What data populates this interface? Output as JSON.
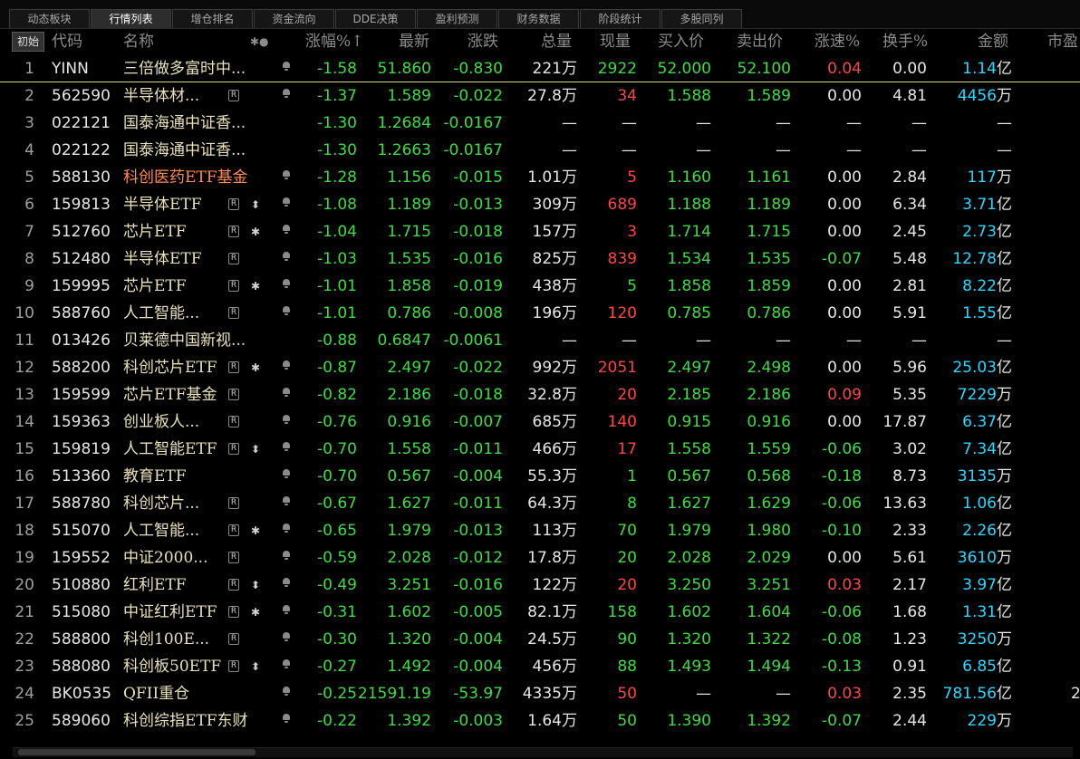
{
  "tabs": [
    "动态板块",
    "行情列表",
    "增仓排名",
    "资金流向",
    "DDE决策",
    "盈利预测",
    "财务数据",
    "阶段统计",
    "多股同列"
  ],
  "active_tab": 1,
  "init_label": "初始",
  "headers": {
    "code": "代码",
    "name": "名称",
    "icons": "✱●",
    "chg_pct": "涨幅%↑",
    "last": "最新",
    "chg": "涨跌",
    "vol": "总量",
    "cur": "现量",
    "bid": "买入价",
    "ask": "卖出价",
    "speed": "涨速%",
    "turnover": "换手%",
    "amount": "金额",
    "mktcap": "市盈"
  },
  "rows": [
    {
      "n": "1",
      "code": "YINN",
      "name": "三倍做多富时中...",
      "tag": "",
      "mark": "",
      "bell": true,
      "chg_pct": "-1.58",
      "last": "51.860",
      "chg": "-0.830",
      "vol": "221",
      "vol_u": "万",
      "cur": "2922",
      "cur_c": "g",
      "bid": "52.000",
      "ask": "52.100",
      "speed": "0.04",
      "speed_c": "r",
      "turn": "0.00",
      "amt": "1.14",
      "amt_u": "亿",
      "hl": false
    },
    {
      "n": "2",
      "code": "562590",
      "name": "半导体材...",
      "tag": "R",
      "mark": "",
      "bell": true,
      "chg_pct": "-1.37",
      "last": "1.589",
      "chg": "-0.022",
      "vol": "27.8",
      "vol_u": "万",
      "cur": "34",
      "cur_c": "r",
      "bid": "1.588",
      "ask": "1.589",
      "speed": "0.00",
      "speed_c": "w",
      "turn": "4.81",
      "amt": "4456",
      "amt_u": "万",
      "hl": false
    },
    {
      "n": "3",
      "code": "022121",
      "name": "国泰海通中证香...",
      "tag": "",
      "mark": "",
      "bell": false,
      "chg_pct": "-1.30",
      "last": "1.2684",
      "chg": "-0.0167",
      "vol": "—",
      "vol_u": "",
      "cur": "—",
      "cur_c": "w",
      "bid": "—",
      "ask": "—",
      "speed": "—",
      "speed_c": "w",
      "turn": "—",
      "amt": "—",
      "amt_u": "",
      "hl": false
    },
    {
      "n": "4",
      "code": "022122",
      "name": "国泰海通中证香...",
      "tag": "",
      "mark": "",
      "bell": false,
      "chg_pct": "-1.30",
      "last": "1.2663",
      "chg": "-0.0167",
      "vol": "—",
      "vol_u": "",
      "cur": "—",
      "cur_c": "w",
      "bid": "—",
      "ask": "—",
      "speed": "—",
      "speed_c": "w",
      "turn": "—",
      "amt": "—",
      "amt_u": "",
      "hl": false
    },
    {
      "n": "5",
      "code": "588130",
      "name": "科创医药ETF基金",
      "tag": "",
      "mark": "",
      "bell": true,
      "chg_pct": "-1.28",
      "last": "1.156",
      "chg": "-0.015",
      "vol": "1.01",
      "vol_u": "万",
      "cur": "5",
      "cur_c": "r",
      "bid": "1.160",
      "ask": "1.161",
      "speed": "0.00",
      "speed_c": "w",
      "turn": "2.84",
      "amt": "117",
      "amt_u": "万",
      "hl": true
    },
    {
      "n": "6",
      "code": "159813",
      "name": "半导体ETF",
      "tag": "R",
      "mark": "⬍",
      "bell": true,
      "chg_pct": "-1.08",
      "last": "1.189",
      "chg": "-0.013",
      "vol": "309",
      "vol_u": "万",
      "cur": "689",
      "cur_c": "r",
      "bid": "1.188",
      "ask": "1.189",
      "speed": "0.00",
      "speed_c": "w",
      "turn": "6.34",
      "amt": "3.71",
      "amt_u": "亿",
      "hl": false
    },
    {
      "n": "7",
      "code": "512760",
      "name": "芯片ETF",
      "tag": "R",
      "mark": "✱",
      "bell": true,
      "chg_pct": "-1.04",
      "last": "1.715",
      "chg": "-0.018",
      "vol": "157",
      "vol_u": "万",
      "cur": "3",
      "cur_c": "r",
      "bid": "1.714",
      "ask": "1.715",
      "speed": "0.00",
      "speed_c": "w",
      "turn": "2.45",
      "amt": "2.73",
      "amt_u": "亿",
      "hl": false
    },
    {
      "n": "8",
      "code": "512480",
      "name": "半导体ETF",
      "tag": "R",
      "mark": "",
      "bell": true,
      "chg_pct": "-1.03",
      "last": "1.535",
      "chg": "-0.016",
      "vol": "825",
      "vol_u": "万",
      "cur": "839",
      "cur_c": "r",
      "bid": "1.534",
      "ask": "1.535",
      "speed": "-0.07",
      "speed_c": "g",
      "turn": "5.48",
      "amt": "12.78",
      "amt_u": "亿",
      "hl": false
    },
    {
      "n": "9",
      "code": "159995",
      "name": "芯片ETF",
      "tag": "R",
      "mark": "✱",
      "bell": true,
      "chg_pct": "-1.01",
      "last": "1.858",
      "chg": "-0.019",
      "vol": "438",
      "vol_u": "万",
      "cur": "5",
      "cur_c": "g",
      "bid": "1.858",
      "ask": "1.859",
      "speed": "0.00",
      "speed_c": "w",
      "turn": "2.81",
      "amt": "8.22",
      "amt_u": "亿",
      "hl": false
    },
    {
      "n": "10",
      "code": "588760",
      "name": "人工智能...",
      "tag": "R",
      "mark": "",
      "bell": true,
      "chg_pct": "-1.01",
      "last": "0.786",
      "chg": "-0.008",
      "vol": "196",
      "vol_u": "万",
      "cur": "120",
      "cur_c": "r",
      "bid": "0.785",
      "ask": "0.786",
      "speed": "0.00",
      "speed_c": "w",
      "turn": "5.91",
      "amt": "1.55",
      "amt_u": "亿",
      "hl": false
    },
    {
      "n": "11",
      "code": "013426",
      "name": "贝莱德中国新视...",
      "tag": "",
      "mark": "",
      "bell": false,
      "chg_pct": "-0.88",
      "last": "0.6847",
      "chg": "-0.0061",
      "vol": "—",
      "vol_u": "",
      "cur": "—",
      "cur_c": "w",
      "bid": "—",
      "ask": "—",
      "speed": "—",
      "speed_c": "w",
      "turn": "—",
      "amt": "—",
      "amt_u": "",
      "hl": false
    },
    {
      "n": "12",
      "code": "588200",
      "name": "科创芯片ETF",
      "tag": "R",
      "mark": "✱",
      "bell": true,
      "chg_pct": "-0.87",
      "last": "2.497",
      "chg": "-0.022",
      "vol": "992",
      "vol_u": "万",
      "cur": "2051",
      "cur_c": "r",
      "bid": "2.497",
      "ask": "2.498",
      "speed": "0.00",
      "speed_c": "w",
      "turn": "5.96",
      "amt": "25.03",
      "amt_u": "亿",
      "hl": false
    },
    {
      "n": "13",
      "code": "159599",
      "name": "芯片ETF基金",
      "tag": "R",
      "mark": "",
      "bell": true,
      "chg_pct": "-0.82",
      "last": "2.186",
      "chg": "-0.018",
      "vol": "32.8",
      "vol_u": "万",
      "cur": "20",
      "cur_c": "r",
      "bid": "2.185",
      "ask": "2.186",
      "speed": "0.09",
      "speed_c": "r",
      "turn": "5.35",
      "amt": "7229",
      "amt_u": "万",
      "hl": false
    },
    {
      "n": "14",
      "code": "159363",
      "name": "创业板人...",
      "tag": "R",
      "mark": "",
      "bell": true,
      "chg_pct": "-0.76",
      "last": "0.916",
      "chg": "-0.007",
      "vol": "685",
      "vol_u": "万",
      "cur": "140",
      "cur_c": "r",
      "bid": "0.915",
      "ask": "0.916",
      "speed": "0.00",
      "speed_c": "w",
      "turn": "17.87",
      "amt": "6.37",
      "amt_u": "亿",
      "hl": false
    },
    {
      "n": "15",
      "code": "159819",
      "name": "人工智能ETF",
      "tag": "R",
      "mark": "⬍",
      "bell": true,
      "chg_pct": "-0.70",
      "last": "1.558",
      "chg": "-0.011",
      "vol": "466",
      "vol_u": "万",
      "cur": "17",
      "cur_c": "r",
      "bid": "1.558",
      "ask": "1.559",
      "speed": "-0.06",
      "speed_c": "g",
      "turn": "3.02",
      "amt": "7.34",
      "amt_u": "亿",
      "hl": false
    },
    {
      "n": "16",
      "code": "513360",
      "name": "教育ETF",
      "tag": "",
      "mark": "",
      "bell": true,
      "chg_pct": "-0.70",
      "last": "0.567",
      "chg": "-0.004",
      "vol": "55.3",
      "vol_u": "万",
      "cur": "1",
      "cur_c": "g",
      "bid": "0.567",
      "ask": "0.568",
      "speed": "-0.18",
      "speed_c": "g",
      "turn": "8.73",
      "amt": "3135",
      "amt_u": "万",
      "hl": false
    },
    {
      "n": "17",
      "code": "588780",
      "name": "科创芯片...",
      "tag": "R",
      "mark": "",
      "bell": true,
      "chg_pct": "-0.67",
      "last": "1.627",
      "chg": "-0.011",
      "vol": "64.3",
      "vol_u": "万",
      "cur": "8",
      "cur_c": "g",
      "bid": "1.627",
      "ask": "1.629",
      "speed": "-0.06",
      "speed_c": "g",
      "turn": "13.63",
      "amt": "1.06",
      "amt_u": "亿",
      "hl": false
    },
    {
      "n": "18",
      "code": "515070",
      "name": "人工智能...",
      "tag": "R",
      "mark": "✱",
      "bell": true,
      "chg_pct": "-0.65",
      "last": "1.979",
      "chg": "-0.013",
      "vol": "113",
      "vol_u": "万",
      "cur": "70",
      "cur_c": "g",
      "bid": "1.979",
      "ask": "1.980",
      "speed": "-0.10",
      "speed_c": "g",
      "turn": "2.33",
      "amt": "2.26",
      "amt_u": "亿",
      "hl": false
    },
    {
      "n": "19",
      "code": "159552",
      "name": "中证2000...",
      "tag": "R",
      "mark": "",
      "bell": true,
      "chg_pct": "-0.59",
      "last": "2.028",
      "chg": "-0.012",
      "vol": "17.8",
      "vol_u": "万",
      "cur": "20",
      "cur_c": "g",
      "bid": "2.028",
      "ask": "2.029",
      "speed": "0.00",
      "speed_c": "w",
      "turn": "5.61",
      "amt": "3610",
      "amt_u": "万",
      "hl": false
    },
    {
      "n": "20",
      "code": "510880",
      "name": "红利ETF",
      "tag": "R",
      "mark": "⬍",
      "bell": true,
      "chg_pct": "-0.49",
      "last": "3.251",
      "chg": "-0.016",
      "vol": "122",
      "vol_u": "万",
      "cur": "20",
      "cur_c": "r",
      "bid": "3.250",
      "ask": "3.251",
      "speed": "0.03",
      "speed_c": "r",
      "turn": "2.17",
      "amt": "3.97",
      "amt_u": "亿",
      "hl": false
    },
    {
      "n": "21",
      "code": "515080",
      "name": "中证红利ETF",
      "tag": "R",
      "mark": "✱",
      "bell": true,
      "chg_pct": "-0.31",
      "last": "1.602",
      "chg": "-0.005",
      "vol": "82.1",
      "vol_u": "万",
      "cur": "158",
      "cur_c": "g",
      "bid": "1.602",
      "ask": "1.604",
      "speed": "-0.06",
      "speed_c": "g",
      "turn": "1.68",
      "amt": "1.31",
      "amt_u": "亿",
      "hl": false
    },
    {
      "n": "22",
      "code": "588800",
      "name": "科创100E...",
      "tag": "R",
      "mark": "",
      "bell": true,
      "chg_pct": "-0.30",
      "last": "1.320",
      "chg": "-0.004",
      "vol": "24.5",
      "vol_u": "万",
      "cur": "90",
      "cur_c": "g",
      "bid": "1.320",
      "ask": "1.322",
      "speed": "-0.08",
      "speed_c": "g",
      "turn": "1.23",
      "amt": "3250",
      "amt_u": "万",
      "hl": false
    },
    {
      "n": "23",
      "code": "588080",
      "name": "科创板50ETF",
      "tag": "R",
      "mark": "⬍",
      "bell": true,
      "chg_pct": "-0.27",
      "last": "1.492",
      "chg": "-0.004",
      "vol": "456",
      "vol_u": "万",
      "cur": "88",
      "cur_c": "g",
      "bid": "1.493",
      "ask": "1.494",
      "speed": "-0.13",
      "speed_c": "g",
      "turn": "0.91",
      "amt": "6.85",
      "amt_u": "亿",
      "hl": false
    },
    {
      "n": "24",
      "code": "BK0535",
      "name": "QFII重仓",
      "tag": "",
      "mark": "",
      "bell": true,
      "chg_pct": "-0.25",
      "last": "21591.19",
      "chg": "-53.97",
      "vol": "4335",
      "vol_u": "万",
      "cur": "50",
      "cur_c": "r",
      "bid": "—",
      "ask": "—",
      "speed": "0.03",
      "speed_c": "r",
      "turn": "2.35",
      "amt": "781.56",
      "amt_u": "亿",
      "hl": false,
      "extra": "2"
    },
    {
      "n": "25",
      "code": "589060",
      "name": "科创综指ETF东财",
      "tag": "",
      "mark": "",
      "bell": true,
      "chg_pct": "-0.22",
      "last": "1.392",
      "chg": "-0.003",
      "vol": "1.64",
      "vol_u": "万",
      "cur": "50",
      "cur_c": "g",
      "bid": "1.390",
      "ask": "1.392",
      "speed": "-0.07",
      "speed_c": "g",
      "turn": "2.44",
      "amt": "229",
      "amt_u": "万",
      "hl": false
    }
  ],
  "colors": {
    "down": "#3ddc44",
    "up": "#ff4444",
    "amount": "#29d8ff",
    "bg": "#000000"
  }
}
